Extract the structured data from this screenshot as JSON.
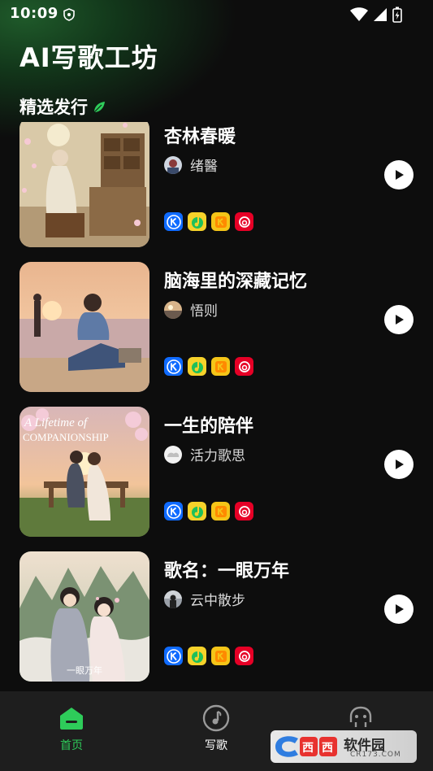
{
  "status_bar": {
    "time": "10:09"
  },
  "app": {
    "title": "AI写歌工坊"
  },
  "section": {
    "title": "精选发行"
  },
  "songs": [
    {
      "title": "杏林春暖",
      "artist": "绪醫"
    },
    {
      "title": "脑海里的深藏记忆",
      "artist": "悟则"
    },
    {
      "title": "一生的陪伴",
      "artist": "活力歌思"
    },
    {
      "title": "歌名：一眼万年",
      "artist": "云中散步"
    }
  ],
  "platform_icons": [
    "kugou-icon",
    "qq-music-icon",
    "kuwo-icon",
    "netease-music-icon"
  ],
  "bottom_nav": {
    "items": [
      {
        "label": "首页",
        "icon": "home-icon",
        "active": true
      },
      {
        "label": "写歌",
        "icon": "music-note-icon",
        "active": false
      },
      {
        "label": "",
        "icon": "profile-icon",
        "active": false
      }
    ]
  },
  "watermark": {
    "text": "软件园",
    "subtext": "CR173.COM"
  },
  "colors": {
    "accent": "#2ecc5a",
    "background": "#0d0d0d",
    "nav_background": "#1e1e1e"
  }
}
